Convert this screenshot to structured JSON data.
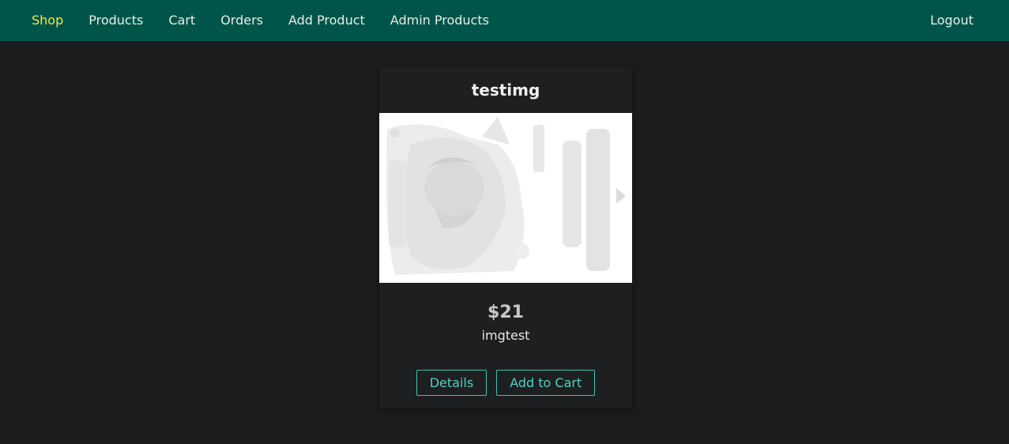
{
  "nav": {
    "items": [
      {
        "label": "Shop",
        "active": true
      },
      {
        "label": "Products"
      },
      {
        "label": "Cart"
      },
      {
        "label": "Orders"
      },
      {
        "label": "Add Product"
      },
      {
        "label": "Admin Products"
      }
    ],
    "logout_label": "Logout"
  },
  "product": {
    "title": "testimg",
    "image_icon": "product-image",
    "price": "$21",
    "description": "imgtest",
    "details_label": "Details",
    "add_to_cart_label": "Add to Cart"
  },
  "colors": {
    "header_bg": "#00554a",
    "active_nav": "#f5e648",
    "accent": "#36c5b3",
    "page_bg": "#1b1c1e"
  }
}
